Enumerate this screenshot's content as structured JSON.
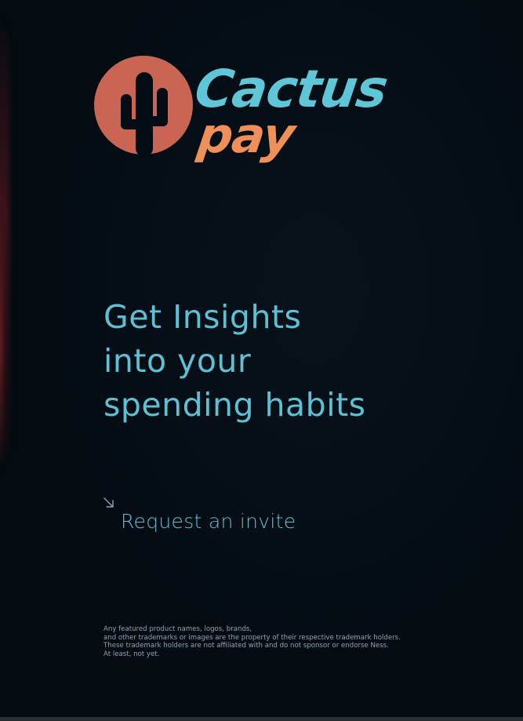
{
  "brand": {
    "logo_word_top": "Cactus",
    "logo_word_bottom": "pay",
    "colors": {
      "circle": "#c96552",
      "word_top": "#5fc6d8",
      "word_bottom": "#ef8f5a",
      "cactus": "#050d14"
    }
  },
  "hero": {
    "line1": "Get Insights",
    "line2": "into your",
    "line3": "spending habits"
  },
  "cta": {
    "arrow_icon": "arrow-down-right-icon",
    "label": "Request an invite"
  },
  "disclaimer": {
    "line1": "Any featured product names, logos, brands,",
    "line2": "and other trademarks or images are the property of their respective trademark holders.",
    "line3": "These trademark holders are not affiliated with and do not sponsor or endorse Ness.",
    "line4": "At least, not yet."
  },
  "colors": {
    "background": "#050d14",
    "accent": "#5fbfd3",
    "muted_text": "#8ea4b1"
  }
}
